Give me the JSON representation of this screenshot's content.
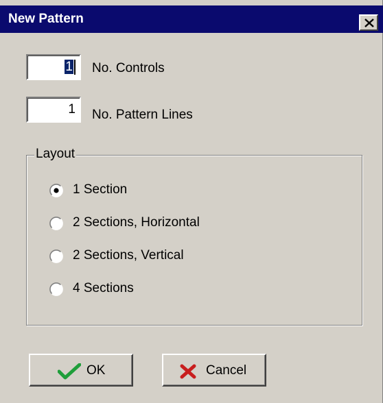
{
  "window": {
    "title": "New Pattern",
    "close_symbol": "×"
  },
  "fields": {
    "controls": {
      "value": "1",
      "label": "No. Controls"
    },
    "pattern_lines": {
      "value": "1",
      "label": "No. Pattern Lines"
    }
  },
  "layout": {
    "legend": "Layout",
    "selected_index": 0,
    "options": [
      {
        "label": "1 Section"
      },
      {
        "label": "2 Sections, Horizontal"
      },
      {
        "label": "2 Sections, Vertical"
      },
      {
        "label": "4 Sections"
      }
    ]
  },
  "buttons": {
    "ok": {
      "label": "OK",
      "icon": "checkmark-icon"
    },
    "cancel": {
      "label": "Cancel",
      "icon": "x-icon"
    }
  },
  "colors": {
    "titlebar": "#0a0a6e",
    "face": "#d4d0c8",
    "check_green": "#1f9e3a",
    "cancel_red": "#c81e1e"
  }
}
